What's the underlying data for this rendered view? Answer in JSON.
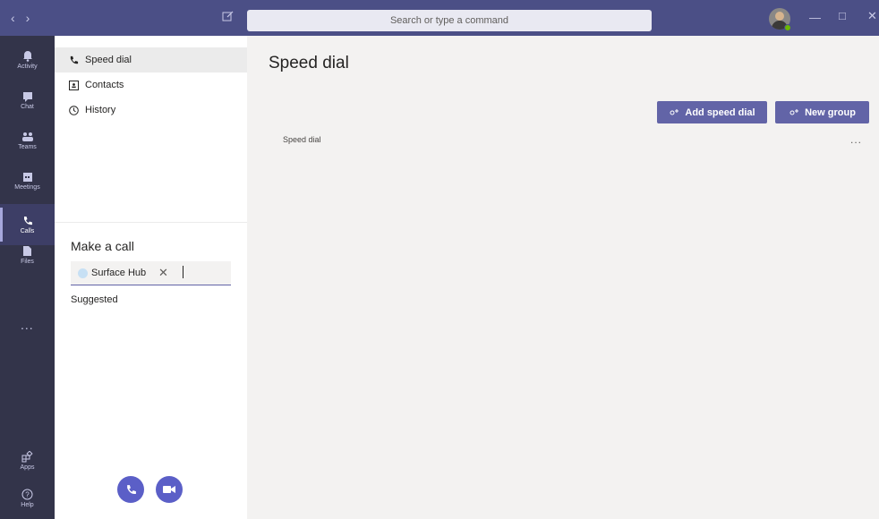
{
  "titlebar": {
    "search_placeholder": "Search or type a command"
  },
  "rail": {
    "items": [
      {
        "label": "Activity",
        "icon": "bell-icon"
      },
      {
        "label": "Chat",
        "icon": "chat-icon"
      },
      {
        "label": "Teams",
        "icon": "teams-icon"
      },
      {
        "label": "Meetings",
        "icon": "calendar-icon"
      },
      {
        "label": "Calls",
        "icon": "phone-icon"
      },
      {
        "label": "Files",
        "icon": "file-icon"
      },
      {
        "label": "Apps",
        "icon": "apps-icon"
      },
      {
        "label": "Help",
        "icon": "help-icon"
      }
    ],
    "more": "...",
    "active": "Calls"
  },
  "leftpane": {
    "nav": [
      {
        "label": "Speed dial",
        "icon": "phone-icon"
      },
      {
        "label": "Contacts",
        "icon": "contacts-icon"
      },
      {
        "label": "History",
        "icon": "clock-icon"
      }
    ],
    "make_call_title": "Make a call",
    "chip_label": "Surface Hub",
    "suggested": "Suggested"
  },
  "main": {
    "title": "Speed dial",
    "add_speed_dial": "Add speed dial",
    "new_group": "New group",
    "section_label": "Speed dial",
    "more": "..."
  },
  "colors": {
    "titlebar": "#4b4f86",
    "rail": "#33344a",
    "accent": "#6264a7",
    "call_button": "#5b5fc7"
  }
}
